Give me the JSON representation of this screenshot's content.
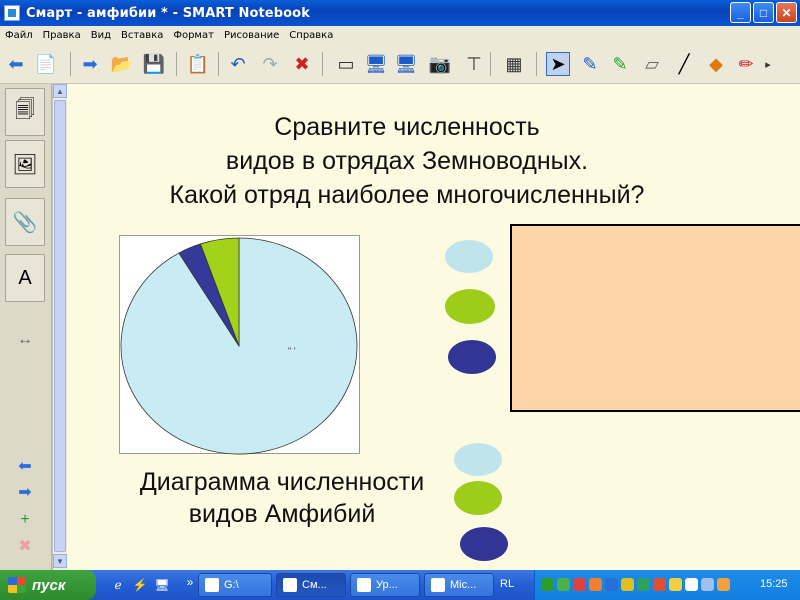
{
  "window": {
    "title": "Смарт - амфибии * - SMART Notebook",
    "minimize_glyph": "_",
    "maximize_glyph": "□",
    "close_glyph": "✕"
  },
  "menu": [
    "Файл",
    "Правка",
    "Вид",
    "Вставка",
    "Формат",
    "Рисование",
    "Справка"
  ],
  "toolbar_icons": [
    {
      "name": "back-icon",
      "glyph": "⬅",
      "color": "#2a6fd8"
    },
    {
      "name": "add-page-icon",
      "glyph": "📄",
      "color": "#2a9d2a"
    },
    {
      "name": "forward-icon",
      "glyph": "➡",
      "color": "#2a6fd8"
    },
    {
      "name": "open-folder-icon",
      "glyph": "📂",
      "color": "#d8a020"
    },
    {
      "name": "save-icon",
      "glyph": "💾",
      "color": "#2a4fb0"
    },
    {
      "name": "paste-icon",
      "glyph": "📋",
      "color": "#666"
    },
    {
      "name": "undo-icon",
      "glyph": "↶",
      "color": "#1d5bc7"
    },
    {
      "name": "redo-icon",
      "glyph": "↷",
      "color": "#9aa"
    },
    {
      "name": "delete-icon",
      "glyph": "✖",
      "color": "#d02020"
    },
    {
      "name": "screen-shade-icon",
      "glyph": "▭",
      "color": "#333"
    },
    {
      "name": "full-screen-icon",
      "glyph": "🖥",
      "color": "#1d5bc7"
    },
    {
      "name": "dual-page-icon",
      "glyph": "🖥",
      "color": "#1d5bc7"
    },
    {
      "name": "capture-icon",
      "glyph": "📷",
      "color": "#444"
    },
    {
      "name": "document-camera-icon",
      "glyph": "⊤",
      "color": "#333"
    },
    {
      "name": "table-icon",
      "glyph": "▦",
      "color": "#333"
    },
    {
      "name": "select-icon",
      "glyph": "➤",
      "color": "#000"
    },
    {
      "name": "pen-icon",
      "glyph": "✎",
      "color": "#1d5bc7"
    },
    {
      "name": "creative-pen-icon",
      "glyph": "✎",
      "color": "#2a9d2a"
    },
    {
      "name": "eraser-icon",
      "glyph": "▱",
      "color": "#666"
    },
    {
      "name": "line-icon",
      "glyph": "╱",
      "color": "#000"
    },
    {
      "name": "shapes-icon",
      "glyph": "◆",
      "color": "#e07a10"
    },
    {
      "name": "magic-pen-icon",
      "glyph": "✏",
      "color": "#d02020"
    },
    {
      "name": "more-icon",
      "glyph": "▸",
      "color": "#333"
    }
  ],
  "side_tabs": [
    {
      "name": "page-sorter-icon",
      "glyph": "🗐"
    },
    {
      "name": "gallery-icon",
      "glyph": "🖼"
    },
    {
      "name": "attachments-icon",
      "glyph": "📎"
    },
    {
      "name": "properties-icon",
      "glyph": "A"
    }
  ],
  "side_icons": [
    {
      "name": "move-sidebar-icon",
      "glyph": "↔",
      "color": "#666"
    },
    {
      "name": "previous-page-icon",
      "glyph": "⬅",
      "color": "#2a6fd8"
    },
    {
      "name": "next-page-icon",
      "glyph": "➡",
      "color": "#2a6fd8"
    },
    {
      "name": "add-page-icon",
      "glyph": "+",
      "color": "#2a9d2a"
    },
    {
      "name": "delete-page-icon",
      "glyph": "✖",
      "color": "#e8a0a0"
    }
  ],
  "page": {
    "question_lines": [
      "Сравните численность",
      "видов в отрядах Земноводных.",
      "Какой отряд наиболее многочисленный?"
    ],
    "chart_label_lines": [
      "Диаграмма численности",
      "видов Амфибий"
    ],
    "pie_label": "\" ’"
  },
  "chart_data": {
    "type": "pie",
    "values": [
      91.5,
      3.2,
      5.3
    ],
    "colors": [
      "#c9ecf4",
      "#35399a",
      "#a3d21a"
    ]
  },
  "ovals": [
    {
      "color": "#bfe4ec"
    },
    {
      "color": "#9dcd1a"
    },
    {
      "color": "#323594"
    },
    {
      "color": "#bfe4ec"
    },
    {
      "color": "#9dcd1a"
    },
    {
      "color": "#323594"
    }
  ],
  "colors": {
    "answer_box": "#ffd4a6"
  },
  "taskbar": {
    "start_label": "пуск",
    "quicklaunch": [
      {
        "name": "ie-icon",
        "glyph": "ℯ"
      },
      {
        "name": "media-icon",
        "glyph": "⚡"
      },
      {
        "name": "desktop-icon",
        "glyph": "🖥"
      }
    ],
    "chevron": "»",
    "tasks": [
      {
        "label": "G:\\",
        "name": "task-drive-g"
      },
      {
        "label": "См...",
        "name": "task-smart-notebook"
      },
      {
        "label": "Ур...",
        "name": "task-word-lesson"
      },
      {
        "label": "Mic...",
        "name": "task-powerpoint"
      }
    ],
    "language": "RL",
    "clock": "15:25"
  }
}
